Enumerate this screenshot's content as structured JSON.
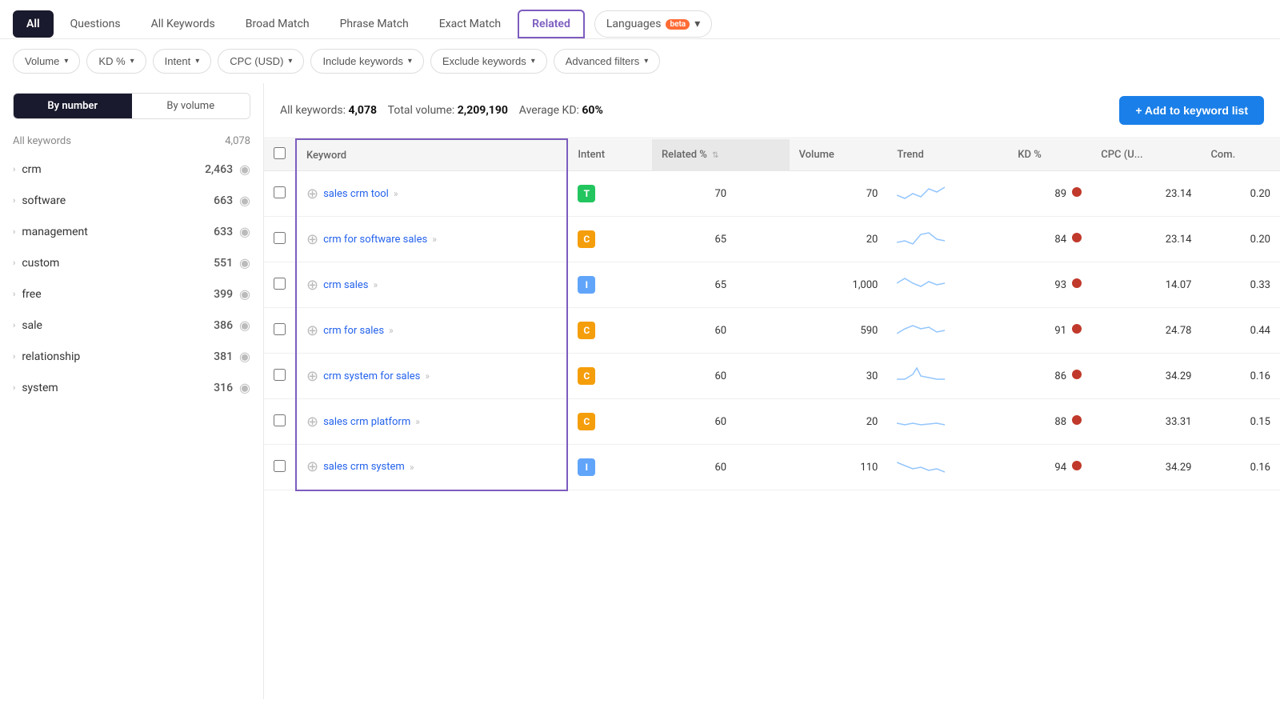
{
  "tabs": [
    {
      "id": "all",
      "label": "All",
      "active": false,
      "all_active": true
    },
    {
      "id": "questions",
      "label": "Questions",
      "active": false
    },
    {
      "id": "all-keywords",
      "label": "All Keywords",
      "active": false
    },
    {
      "id": "broad-match",
      "label": "Broad Match",
      "active": false
    },
    {
      "id": "phrase-match",
      "label": "Phrase Match",
      "active": false
    },
    {
      "id": "exact-match",
      "label": "Exact Match",
      "active": false
    },
    {
      "id": "related",
      "label": "Related",
      "active": true
    }
  ],
  "languages": {
    "label": "Languages",
    "badge": "beta"
  },
  "filters": [
    {
      "id": "volume",
      "label": "Volume"
    },
    {
      "id": "kd",
      "label": "KD %"
    },
    {
      "id": "intent",
      "label": "Intent"
    },
    {
      "id": "cpc",
      "label": "CPC (USD)"
    },
    {
      "id": "include",
      "label": "Include keywords"
    },
    {
      "id": "exclude",
      "label": "Exclude keywords"
    },
    {
      "id": "advanced",
      "label": "Advanced filters"
    }
  ],
  "view_toggle": {
    "by_number": "By number",
    "by_volume": "By volume"
  },
  "sidebar": {
    "header_label": "All keywords",
    "header_count": "4,078",
    "items": [
      {
        "keyword": "crm",
        "count": "2,463"
      },
      {
        "keyword": "software",
        "count": "663"
      },
      {
        "keyword": "management",
        "count": "633"
      },
      {
        "keyword": "custom",
        "count": "551"
      },
      {
        "keyword": "free",
        "count": "399"
      },
      {
        "keyword": "sale",
        "count": "386"
      },
      {
        "keyword": "relationship",
        "count": "381"
      },
      {
        "keyword": "system",
        "count": "316"
      }
    ]
  },
  "stats": {
    "all_keywords_label": "All keywords:",
    "all_keywords_value": "4,078",
    "total_volume_label": "Total volume:",
    "total_volume_value": "2,209,190",
    "avg_kd_label": "Average KD:",
    "avg_kd_value": "60%"
  },
  "add_button": "+ Add to keyword list",
  "table": {
    "headers": [
      {
        "id": "check",
        "label": ""
      },
      {
        "id": "keyword",
        "label": "Keyword"
      },
      {
        "id": "intent",
        "label": "Intent"
      },
      {
        "id": "related",
        "label": "Related %"
      },
      {
        "id": "volume",
        "label": "Volume"
      },
      {
        "id": "trend",
        "label": "Trend"
      },
      {
        "id": "kd",
        "label": "KD %"
      },
      {
        "id": "cpc",
        "label": "CPC (U..."
      },
      {
        "id": "com",
        "label": "Com."
      }
    ],
    "rows": [
      {
        "keyword": "sales crm tool",
        "intent": "T",
        "related": "70",
        "volume": "70",
        "kd": "89",
        "cpc": "23.14",
        "com": "0.20",
        "trend": "down-up"
      },
      {
        "keyword": "crm for software sales",
        "intent": "C",
        "related": "65",
        "volume": "20",
        "kd": "84",
        "cpc": "23.14",
        "com": "0.20",
        "trend": "up-spike"
      },
      {
        "keyword": "crm sales",
        "intent": "I",
        "related": "65",
        "volume": "1,000",
        "kd": "93",
        "cpc": "14.07",
        "com": "0.33",
        "trend": "wave"
      },
      {
        "keyword": "crm for sales",
        "intent": "C",
        "related": "60",
        "volume": "590",
        "kd": "91",
        "cpc": "24.78",
        "com": "0.44",
        "trend": "up-down"
      },
      {
        "keyword": "crm system for sales",
        "intent": "C",
        "related": "60",
        "volume": "30",
        "kd": "86",
        "cpc": "34.29",
        "com": "0.16",
        "trend": "spike-up"
      },
      {
        "keyword": "sales crm platform",
        "intent": "C",
        "related": "60",
        "volume": "20",
        "kd": "88",
        "cpc": "33.31",
        "com": "0.15",
        "trend": "flat"
      },
      {
        "keyword": "sales crm system",
        "intent": "I",
        "related": "60",
        "volume": "110",
        "kd": "94",
        "cpc": "34.29",
        "com": "0.16",
        "trend": "down-wave"
      }
    ]
  }
}
